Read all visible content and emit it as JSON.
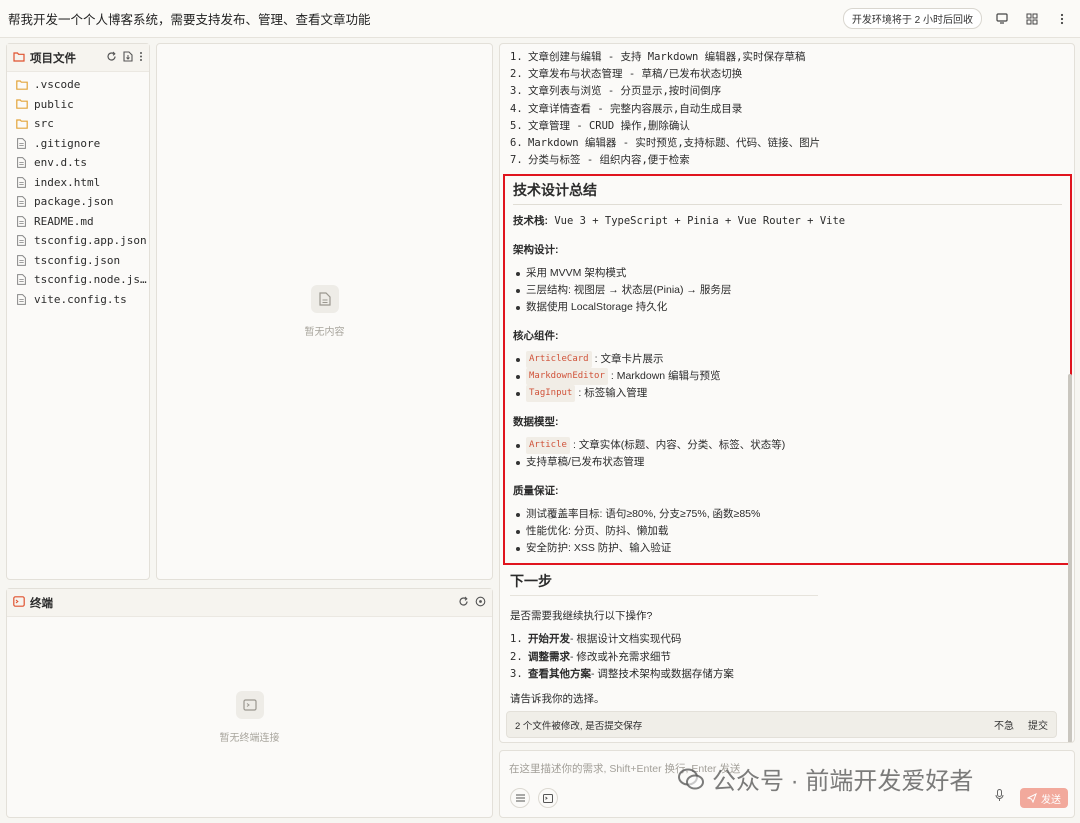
{
  "topbar": {
    "title": "帮我开发一个个人博客系统，需要支持发布、管理、查看文章功能",
    "env_badge": "开发环境将于 2 小时后回收"
  },
  "files_panel": {
    "title": "项目文件",
    "items": [
      {
        "name": ".vscode",
        "type": "folder"
      },
      {
        "name": "public",
        "type": "folder"
      },
      {
        "name": "src",
        "type": "folder"
      },
      {
        "name": ".gitignore",
        "type": "file"
      },
      {
        "name": "env.d.ts",
        "type": "file"
      },
      {
        "name": "index.html",
        "type": "file"
      },
      {
        "name": "package.json",
        "type": "file"
      },
      {
        "name": "README.md",
        "type": "file"
      },
      {
        "name": "tsconfig.app.json",
        "type": "file"
      },
      {
        "name": "tsconfig.json",
        "type": "file"
      },
      {
        "name": "tsconfig.node.json",
        "type": "file"
      },
      {
        "name": "vite.config.ts",
        "type": "file"
      }
    ]
  },
  "editor": {
    "empty_text": "暂无内容"
  },
  "terminal": {
    "title": "终端",
    "empty_text": "暂无终端连接"
  },
  "chat": {
    "features": [
      {
        "num": "1.",
        "text": "文章创建与编辑 - 支持 Markdown 编辑器,实时保存草稿"
      },
      {
        "num": "2.",
        "text": "文章发布与状态管理 - 草稿/已发布状态切换"
      },
      {
        "num": "3.",
        "text": "文章列表与浏览 - 分页显示,按时间倒序"
      },
      {
        "num": "4.",
        "text": "文章详情查看 - 完整内容展示,自动生成目录"
      },
      {
        "num": "5.",
        "text": "文章管理 - CRUD 操作,删除确认"
      },
      {
        "num": "6.",
        "text": "Markdown 编辑器 - 实时预览,支持标题、代码、链接、图片"
      },
      {
        "num": "7.",
        "text": "分类与标签 - 组织内容,便于检索"
      }
    ],
    "summary": {
      "title": "技术设计总结",
      "stack_label": "技术栈:",
      "stack_value": " Vue 3 + TypeScript + Pinia + Vue Router + Vite",
      "arch_label": "架构设计:",
      "arch_items": [
        "采用 MVVM 架构模式",
        "三层结构: 视图层 → 状态层(Pinia) → 服务层",
        "数据使用 LocalStorage 持久化"
      ],
      "comp_label": "核心组件:",
      "components": [
        {
          "code": "ArticleCard",
          "desc": ": 文章卡片展示"
        },
        {
          "code": "MarkdownEditor",
          "desc": ": Markdown 编辑与预览"
        },
        {
          "code": "TagInput",
          "desc": ": 标签输入管理"
        }
      ],
      "model_label": "数据模型:",
      "model_code": "Article",
      "model_desc": ": 文章实体(标题、内容、分类、标签、状态等)",
      "model_item2": "支持草稿/已发布状态管理",
      "qa_label": "质量保证:",
      "qa_items": [
        "测试覆盖率目标: 语句≥80%, 分支≥75%, 函数≥85%",
        "性能优化: 分页、防抖、懒加载",
        "安全防护: XSS 防护、输入验证"
      ]
    },
    "next": {
      "title": "下一步",
      "ask": "是否需要我继续执行以下操作?",
      "options": [
        {
          "num": "1.",
          "bold": "开始开发",
          "rest": " - 根据设计文档实现代码"
        },
        {
          "num": "2.",
          "bold": "调整需求",
          "rest": " - 修改或补充需求细节"
        },
        {
          "num": "3.",
          "bold": "查看其他方案",
          "rest": " - 调整技术架构或数据存储方案"
        }
      ],
      "choose": "请告诉我你的选择。"
    },
    "save_bar": {
      "text": "2 个文件被修改, 是否提交保存",
      "cancel": "不急",
      "submit": "提交"
    }
  },
  "input": {
    "placeholder": "在这里描述你的需求, Shift+Enter 换行, Enter 发送",
    "send_label": "发送"
  },
  "watermark": "公众号 · 前端开发爱好者"
}
